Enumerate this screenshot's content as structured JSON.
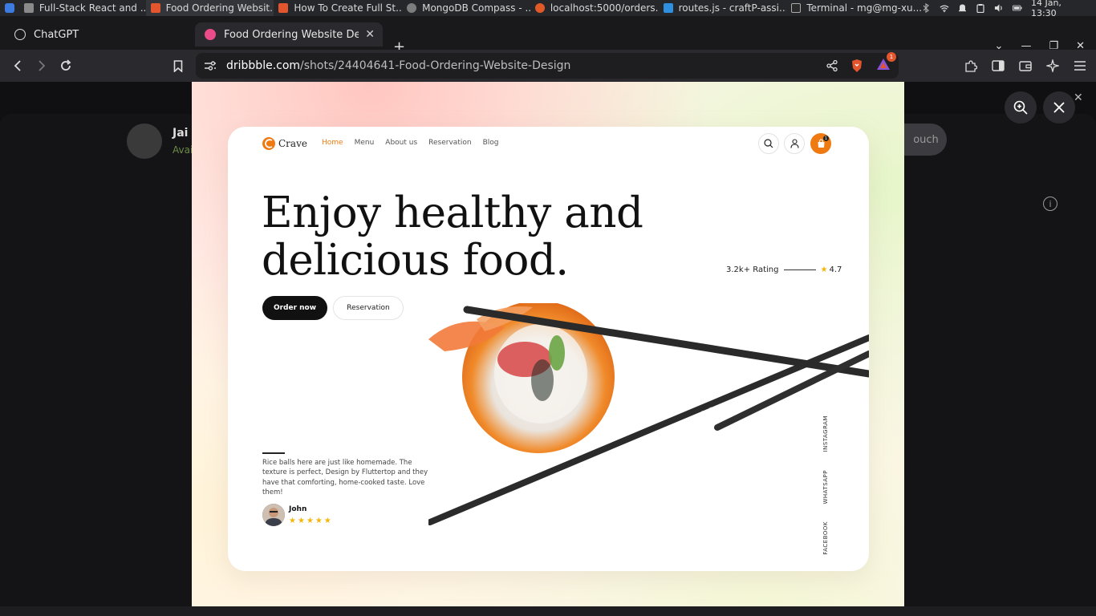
{
  "taskbar": {
    "tasks": [
      {
        "label": "Full-Stack React and ..."
      },
      {
        "label": "Food Ordering Websit..."
      },
      {
        "label": "How To Create Full St..."
      },
      {
        "label": "MongoDB Compass - ..."
      },
      {
        "label": "localhost:5000/orders..."
      },
      {
        "label": "routes.js - craftP-assi..."
      },
      {
        "label": "Terminal - mg@mg-xu..."
      }
    ],
    "clock": "14 Jan, 13:30"
  },
  "browser": {
    "tabs": [
      {
        "label": "ChatGPT"
      },
      {
        "label": "Food Ordering Website Desig"
      }
    ],
    "url_domain": "dribbble.com",
    "url_path": "/shots/24404641-Food-Ordering-Website-Design",
    "notification_count": "1"
  },
  "page": {
    "designer_name": "Jai S",
    "designer_status": "Avai",
    "touch_button": "ouch"
  },
  "shot": {
    "brand": "Crave",
    "menu": [
      "Home",
      "Menu",
      "About us",
      "Reservation",
      "Blog"
    ],
    "cart_count": "1",
    "hero_line1": "Enjoy healthy and",
    "hero_line2": "delicious food.",
    "order_button": "Order now",
    "reservation_button": "Reservation",
    "rating_label": "3.2k+ Rating",
    "rating_value": "4.7",
    "quote": "Rice balls here are just like homemade. The texture is perfect, Design by Fluttertop and they have that comforting, home-cooked taste. Love them!",
    "reviewer": "John",
    "review_stars": 5,
    "social": [
      "INSTAGRAM",
      "WHATSAPP",
      "FACEBOOK"
    ],
    "watermark": "Design by Fluttertop",
    "accent": "#f07a12",
    "star_color": "#f5b50a"
  }
}
